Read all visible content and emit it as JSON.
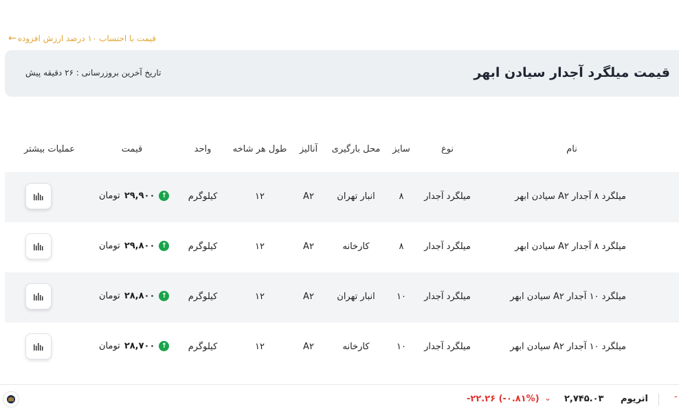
{
  "vat_link": "قیمت با احتساب ۱۰ درصد ارزش افزوده",
  "header": {
    "title": "قیمت میلگرد آجدار سیادن ابهر",
    "update": "تاریخ آخرین بروزرسانی : ۲۶ دقیقه پیش"
  },
  "columns": {
    "name": "نام",
    "type": "نوع",
    "size": "سایز",
    "location": "محل بارگیری",
    "analysis": "آنالیز",
    "length": "طول هر شاخه",
    "unit": "واحد",
    "price": "قیمت",
    "actions": "عملیات بیشتر"
  },
  "rows": [
    {
      "name": "میلگرد ۸ آجدار A۲ سیادن ابهر",
      "type": "میلگرد آجدار",
      "size": "۸",
      "location": "انبار تهران",
      "analysis": "A۲",
      "length": "۱۲",
      "unit": "کیلوگرم",
      "price": "۲۹,۹۰۰",
      "currency": "تومان"
    },
    {
      "name": "میلگرد ۸ آجدار A۲ سیادن ابهر",
      "type": "میلگرد آجدار",
      "size": "۸",
      "location": "کارخانه",
      "analysis": "A۲",
      "length": "۱۲",
      "unit": "کیلوگرم",
      "price": "۲۹,۸۰۰",
      "currency": "تومان"
    },
    {
      "name": "میلگرد ۱۰ آجدار A۲ سیادن ابهر",
      "type": "میلگرد آجدار",
      "size": "۱۰",
      "location": "انبار تهران",
      "analysis": "A۲",
      "length": "۱۲",
      "unit": "کیلوگرم",
      "price": "۲۸,۸۰۰",
      "currency": "تومان"
    },
    {
      "name": "میلگرد ۱۰ آجدار A۲ سیادن ابهر",
      "type": "میلگرد آجدار",
      "size": "۱۰",
      "location": "کارخانه",
      "analysis": "A۲",
      "length": "۱۲",
      "unit": "کیلوگرم",
      "price": "۲۸,۷۰۰",
      "currency": "تومان"
    }
  ],
  "ticker": {
    "name": "اتریوم",
    "price": "۲,۷۴۵.۰۳",
    "change": "-۲۲.۲۶  (-۰.۸۱%)",
    "change_color": "#e0342f"
  },
  "colors": {
    "accent": "#e0a63a",
    "up": "#19a34a",
    "header_bg": "#edf0f3"
  }
}
